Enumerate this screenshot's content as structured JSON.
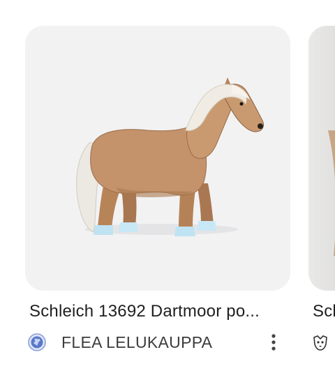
{
  "results": [
    {
      "title": "Schleich 13692 Dartmoor po...",
      "source": "FLEA LELUKAUPPA",
      "favicon_icon": "globe-icon",
      "menu_icon": "more-vert-icon"
    },
    {
      "title": "Scl",
      "favicon_icon": "dog-icon"
    }
  ],
  "colors": {
    "thumb_bg": "#f2f2f3",
    "title_text": "#1f1f1f",
    "source_text": "#3c3c3c"
  }
}
